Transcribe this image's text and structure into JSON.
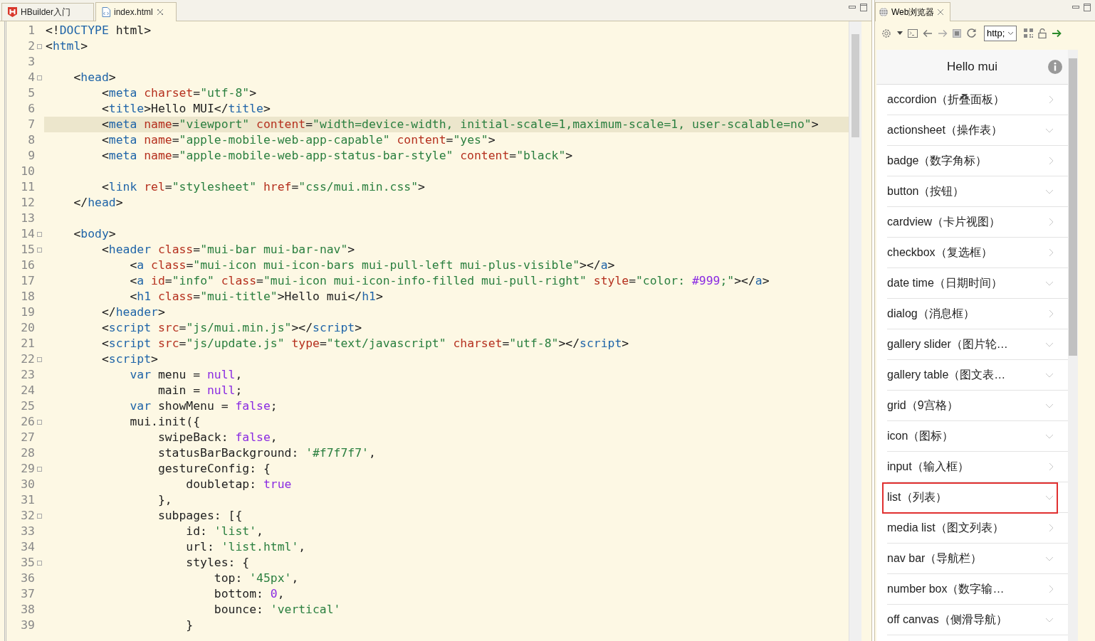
{
  "editor": {
    "tabs": [
      {
        "label": "HBuilder入门",
        "selected": false,
        "closable": false
      },
      {
        "label": "index.html",
        "selected": true,
        "closable": true
      }
    ],
    "lines": [
      {
        "number": "1",
        "fold": false,
        "current": false,
        "tokens": [
          {
            "kind": "plain",
            "text": "<!"
          },
          {
            "kind": "tag",
            "text": "DOCTYPE"
          },
          {
            "kind": "plain",
            "text": " html>"
          }
        ]
      },
      {
        "number": "2",
        "fold": true,
        "current": false,
        "tokens": [
          {
            "kind": "plain",
            "text": "<"
          },
          {
            "kind": "tag",
            "text": "html"
          },
          {
            "kind": "plain",
            "text": ">"
          }
        ]
      },
      {
        "number": "3",
        "fold": false,
        "current": false
      },
      {
        "number": "4",
        "fold": true,
        "current": false,
        "tokens": [
          {
            "kind": "plain",
            "text": "    <"
          },
          {
            "kind": "tag",
            "text": "head"
          },
          {
            "kind": "plain",
            "text": ">"
          }
        ]
      },
      {
        "number": "5",
        "fold": false,
        "current": false,
        "tokens": [
          {
            "kind": "plain",
            "text": "        <"
          },
          {
            "kind": "tag",
            "text": "meta"
          },
          {
            "kind": "attr",
            "text": " charset"
          },
          {
            "kind": "plain",
            "text": "="
          },
          {
            "kind": "string",
            "text": "\"utf-8\""
          },
          {
            "kind": "plain",
            "text": ">"
          }
        ]
      },
      {
        "number": "6",
        "fold": false,
        "current": false,
        "tokens": [
          {
            "kind": "plain",
            "text": "        <"
          },
          {
            "kind": "tag",
            "text": "title"
          },
          {
            "kind": "plain",
            "text": ">Hello MUI</"
          },
          {
            "kind": "tag",
            "text": "title"
          },
          {
            "kind": "plain",
            "text": ">"
          }
        ]
      },
      {
        "number": "7",
        "fold": false,
        "current": true,
        "tokens": [
          {
            "kind": "plain",
            "text": "        <"
          },
          {
            "kind": "tag",
            "text": "meta"
          },
          {
            "kind": "attr",
            "text": " name"
          },
          {
            "kind": "plain",
            "text": "="
          },
          {
            "kind": "string",
            "text": "\"viewport\""
          },
          {
            "kind": "attr",
            "text": " content"
          },
          {
            "kind": "plain",
            "text": "="
          },
          {
            "kind": "string",
            "text": "\"width=device-width, initial-scale=1,maximum-scale=1, user-scalable=no\""
          },
          {
            "kind": "plain",
            "text": ">"
          }
        ]
      },
      {
        "number": "8",
        "fold": false,
        "current": false,
        "tokens": [
          {
            "kind": "plain",
            "text": "        <"
          },
          {
            "kind": "tag",
            "text": "meta"
          },
          {
            "kind": "attr",
            "text": " name"
          },
          {
            "kind": "plain",
            "text": "="
          },
          {
            "kind": "string",
            "text": "\"apple-mobile-web-app-capable\""
          },
          {
            "kind": "attr",
            "text": " content"
          },
          {
            "kind": "plain",
            "text": "="
          },
          {
            "kind": "string",
            "text": "\"yes\""
          },
          {
            "kind": "plain",
            "text": ">"
          }
        ]
      },
      {
        "number": "9",
        "fold": false,
        "current": false,
        "tokens": [
          {
            "kind": "plain",
            "text": "        <"
          },
          {
            "kind": "tag",
            "text": "meta"
          },
          {
            "kind": "attr",
            "text": " name"
          },
          {
            "kind": "plain",
            "text": "="
          },
          {
            "kind": "string",
            "text": "\"apple-mobile-web-app-status-bar-style\""
          },
          {
            "kind": "attr",
            "text": " content"
          },
          {
            "kind": "plain",
            "text": "="
          },
          {
            "kind": "string",
            "text": "\"black\""
          },
          {
            "kind": "plain",
            "text": ">"
          }
        ]
      },
      {
        "number": "10",
        "fold": false,
        "current": false
      },
      {
        "number": "11",
        "fold": false,
        "current": false,
        "tokens": [
          {
            "kind": "plain",
            "text": "        <"
          },
          {
            "kind": "tag",
            "text": "link"
          },
          {
            "kind": "attr",
            "text": " rel"
          },
          {
            "kind": "plain",
            "text": "="
          },
          {
            "kind": "string",
            "text": "\"stylesheet\""
          },
          {
            "kind": "attr",
            "text": " href"
          },
          {
            "kind": "plain",
            "text": "="
          },
          {
            "kind": "string",
            "text": "\"css/mui.min.css\""
          },
          {
            "kind": "plain",
            "text": ">"
          }
        ]
      },
      {
        "number": "12",
        "fold": false,
        "current": false,
        "tokens": [
          {
            "kind": "plain",
            "text": "    </"
          },
          {
            "kind": "tag",
            "text": "head"
          },
          {
            "kind": "plain",
            "text": ">"
          }
        ]
      },
      {
        "number": "13",
        "fold": false,
        "current": false
      },
      {
        "number": "14",
        "fold": true,
        "current": false,
        "tokens": [
          {
            "kind": "plain",
            "text": "    <"
          },
          {
            "kind": "tag",
            "text": "body"
          },
          {
            "kind": "plain",
            "text": ">"
          }
        ]
      },
      {
        "number": "15",
        "fold": true,
        "current": false,
        "tokens": [
          {
            "kind": "plain",
            "text": "        <"
          },
          {
            "kind": "tag",
            "text": "header"
          },
          {
            "kind": "attr",
            "text": " class"
          },
          {
            "kind": "plain",
            "text": "="
          },
          {
            "kind": "string",
            "text": "\"mui-bar mui-bar-nav\""
          },
          {
            "kind": "plain",
            "text": ">"
          }
        ]
      },
      {
        "number": "16",
        "fold": false,
        "current": false,
        "tokens": [
          {
            "kind": "plain",
            "text": "            <"
          },
          {
            "kind": "tag",
            "text": "a"
          },
          {
            "kind": "attr",
            "text": " class"
          },
          {
            "kind": "plain",
            "text": "="
          },
          {
            "kind": "string",
            "text": "\"mui-icon mui-icon-bars mui-pull-left mui-plus-visible\""
          },
          {
            "kind": "plain",
            "text": "></"
          },
          {
            "kind": "tag",
            "text": "a"
          },
          {
            "kind": "plain",
            "text": ">"
          }
        ]
      },
      {
        "number": "17",
        "fold": false,
        "current": false,
        "tokens": [
          {
            "kind": "plain",
            "text": "            <"
          },
          {
            "kind": "tag",
            "text": "a"
          },
          {
            "kind": "attr",
            "text": " id"
          },
          {
            "kind": "plain",
            "text": "="
          },
          {
            "kind": "string",
            "text": "\"info\""
          },
          {
            "kind": "attr",
            "text": " class"
          },
          {
            "kind": "plain",
            "text": "="
          },
          {
            "kind": "string",
            "text": "\"mui-icon mui-icon-info-filled mui-pull-right\""
          },
          {
            "kind": "attr",
            "text": " style"
          },
          {
            "kind": "plain",
            "text": "="
          },
          {
            "kind": "string",
            "text": "\"color: "
          },
          {
            "kind": "keyword",
            "text": "#999"
          },
          {
            "kind": "string",
            "text": ";\""
          },
          {
            "kind": "plain",
            "text": "></"
          },
          {
            "kind": "tag",
            "text": "a"
          },
          {
            "kind": "plain",
            "text": ">"
          }
        ]
      },
      {
        "number": "18",
        "fold": false,
        "current": false,
        "tokens": [
          {
            "kind": "plain",
            "text": "            <"
          },
          {
            "kind": "tag",
            "text": "h1"
          },
          {
            "kind": "attr",
            "text": " class"
          },
          {
            "kind": "plain",
            "text": "="
          },
          {
            "kind": "string",
            "text": "\"mui-title\""
          },
          {
            "kind": "plain",
            "text": ">Hello mui</"
          },
          {
            "kind": "tag",
            "text": "h1"
          },
          {
            "kind": "plain",
            "text": ">"
          }
        ]
      },
      {
        "number": "19",
        "fold": false,
        "current": false,
        "tokens": [
          {
            "kind": "plain",
            "text": "        </"
          },
          {
            "kind": "tag",
            "text": "header"
          },
          {
            "kind": "plain",
            "text": ">"
          }
        ]
      },
      {
        "number": "20",
        "fold": false,
        "current": false,
        "tokens": [
          {
            "kind": "plain",
            "text": "        <"
          },
          {
            "kind": "tag",
            "text": "script"
          },
          {
            "kind": "attr",
            "text": " src"
          },
          {
            "kind": "plain",
            "text": "="
          },
          {
            "kind": "string",
            "text": "\"js/mui.min.js\""
          },
          {
            "kind": "plain",
            "text": "></"
          },
          {
            "kind": "tag",
            "text": "script"
          },
          {
            "kind": "plain",
            "text": ">"
          }
        ]
      },
      {
        "number": "21",
        "fold": false,
        "current": false,
        "tokens": [
          {
            "kind": "plain",
            "text": "        <"
          },
          {
            "kind": "tag",
            "text": "script"
          },
          {
            "kind": "attr",
            "text": " src"
          },
          {
            "kind": "plain",
            "text": "="
          },
          {
            "kind": "string",
            "text": "\"js/update.js\""
          },
          {
            "kind": "attr",
            "text": " type"
          },
          {
            "kind": "plain",
            "text": "="
          },
          {
            "kind": "string",
            "text": "\"text/javascript\""
          },
          {
            "kind": "attr",
            "text": " charset"
          },
          {
            "kind": "plain",
            "text": "="
          },
          {
            "kind": "string",
            "text": "\"utf-8\""
          },
          {
            "kind": "plain",
            "text": "></"
          },
          {
            "kind": "tag",
            "text": "script"
          },
          {
            "kind": "plain",
            "text": ">"
          }
        ]
      },
      {
        "number": "22",
        "fold": true,
        "current": false,
        "tokens": [
          {
            "kind": "plain",
            "text": "        <"
          },
          {
            "kind": "tag",
            "text": "script"
          },
          {
            "kind": "plain",
            "text": ">"
          }
        ]
      },
      {
        "number": "23",
        "fold": false,
        "current": false,
        "tokens": [
          {
            "kind": "tag",
            "text": "            var"
          },
          {
            "kind": "plain",
            "text": " menu = "
          },
          {
            "kind": "keyword",
            "text": "null"
          },
          {
            "kind": "plain",
            "text": ","
          }
        ]
      },
      {
        "number": "24",
        "fold": false,
        "current": false,
        "tokens": [
          {
            "kind": "plain",
            "text": "                main = "
          },
          {
            "kind": "keyword",
            "text": "null"
          },
          {
            "kind": "plain",
            "text": ";"
          }
        ]
      },
      {
        "number": "25",
        "fold": false,
        "current": false,
        "tokens": [
          {
            "kind": "tag",
            "text": "            var"
          },
          {
            "kind": "plain",
            "text": " showMenu = "
          },
          {
            "kind": "keyword",
            "text": "false"
          },
          {
            "kind": "plain",
            "text": ";"
          }
        ]
      },
      {
        "number": "26",
        "fold": true,
        "current": false,
        "tokens": [
          {
            "kind": "plain",
            "text": "            mui.init({"
          }
        ]
      },
      {
        "number": "27",
        "fold": false,
        "current": false,
        "tokens": [
          {
            "kind": "plain",
            "text": "                swipeBack: "
          },
          {
            "kind": "keyword",
            "text": "false"
          },
          {
            "kind": "plain",
            "text": ","
          }
        ]
      },
      {
        "number": "28",
        "fold": false,
        "current": false,
        "tokens": [
          {
            "kind": "plain",
            "text": "                statusBarBackground: "
          },
          {
            "kind": "string",
            "text": "'#f7f7f7'"
          },
          {
            "kind": "plain",
            "text": ","
          }
        ]
      },
      {
        "number": "29",
        "fold": true,
        "current": false,
        "tokens": [
          {
            "kind": "plain",
            "text": "                gestureConfig: {"
          }
        ]
      },
      {
        "number": "30",
        "fold": false,
        "current": false,
        "tokens": [
          {
            "kind": "plain",
            "text": "                    doubletap: "
          },
          {
            "kind": "keyword",
            "text": "true"
          }
        ]
      },
      {
        "number": "31",
        "fold": false,
        "current": false,
        "tokens": [
          {
            "kind": "plain",
            "text": "                },"
          }
        ]
      },
      {
        "number": "32",
        "fold": true,
        "current": false,
        "tokens": [
          {
            "kind": "plain",
            "text": "                subpages: [{"
          }
        ]
      },
      {
        "number": "33",
        "fold": false,
        "current": false,
        "tokens": [
          {
            "kind": "plain",
            "text": "                    id: "
          },
          {
            "kind": "string",
            "text": "'list'"
          },
          {
            "kind": "plain",
            "text": ","
          }
        ]
      },
      {
        "number": "34",
        "fold": false,
        "current": false,
        "tokens": [
          {
            "kind": "plain",
            "text": "                    url: "
          },
          {
            "kind": "string",
            "text": "'list.html'"
          },
          {
            "kind": "plain",
            "text": ","
          }
        ]
      },
      {
        "number": "35",
        "fold": true,
        "current": false,
        "tokens": [
          {
            "kind": "plain",
            "text": "                    styles: {"
          }
        ]
      },
      {
        "number": "36",
        "fold": false,
        "current": false,
        "tokens": [
          {
            "kind": "plain",
            "text": "                        top: "
          },
          {
            "kind": "string",
            "text": "'45px'"
          },
          {
            "kind": "plain",
            "text": ","
          }
        ]
      },
      {
        "number": "37",
        "fold": false,
        "current": false,
        "tokens": [
          {
            "kind": "plain",
            "text": "                        bottom: "
          },
          {
            "kind": "keyword",
            "text": "0"
          },
          {
            "kind": "plain",
            "text": ","
          }
        ]
      },
      {
        "number": "38",
        "fold": false,
        "current": false,
        "tokens": [
          {
            "kind": "plain",
            "text": "                        bounce: "
          },
          {
            "kind": "string",
            "text": "'vertical'"
          }
        ]
      },
      {
        "number": "39",
        "fold": false,
        "current": false,
        "tokens": [
          {
            "kind": "plain",
            "text": "                    }"
          }
        ]
      }
    ]
  },
  "browser": {
    "tab": {
      "label": "Web浏览器"
    },
    "url": "http;",
    "page_title": "Hello mui",
    "items": [
      {
        "label": "accordion（折叠面板）",
        "kind": "link",
        "highlighted": false
      },
      {
        "label": "actionsheet（操作表）",
        "kind": "expandable",
        "highlighted": false
      },
      {
        "label": "badge（数字角标）",
        "kind": "link",
        "highlighted": false
      },
      {
        "label": "button（按钮）",
        "kind": "expandable",
        "highlighted": false
      },
      {
        "label": "cardview（卡片视图）",
        "kind": "link",
        "highlighted": false
      },
      {
        "label": "checkbox（复选框）",
        "kind": "link",
        "highlighted": false
      },
      {
        "label": "date time（日期时间）",
        "kind": "expandable",
        "highlighted": false
      },
      {
        "label": "dialog（消息框）",
        "kind": "link",
        "highlighted": false
      },
      {
        "label": "gallery slider（图片轮…",
        "kind": "expandable",
        "highlighted": false
      },
      {
        "label": "gallery table（图文表…",
        "kind": "expandable",
        "highlighted": false
      },
      {
        "label": "grid（9宫格）",
        "kind": "expandable",
        "highlighted": false
      },
      {
        "label": "icon（图标）",
        "kind": "expandable",
        "highlighted": false
      },
      {
        "label": "input（输入框）",
        "kind": "link",
        "highlighted": false
      },
      {
        "label": "list（列表）",
        "kind": "expandable",
        "highlighted": true
      },
      {
        "label": "media list（图文列表）",
        "kind": "link",
        "highlighted": false
      },
      {
        "label": "nav bar（导航栏）",
        "kind": "expandable",
        "highlighted": false
      },
      {
        "label": "number box（数字输…",
        "kind": "link",
        "highlighted": false
      },
      {
        "label": "off canvas（侧滑导航）",
        "kind": "expandable",
        "highlighted": false
      }
    ]
  }
}
